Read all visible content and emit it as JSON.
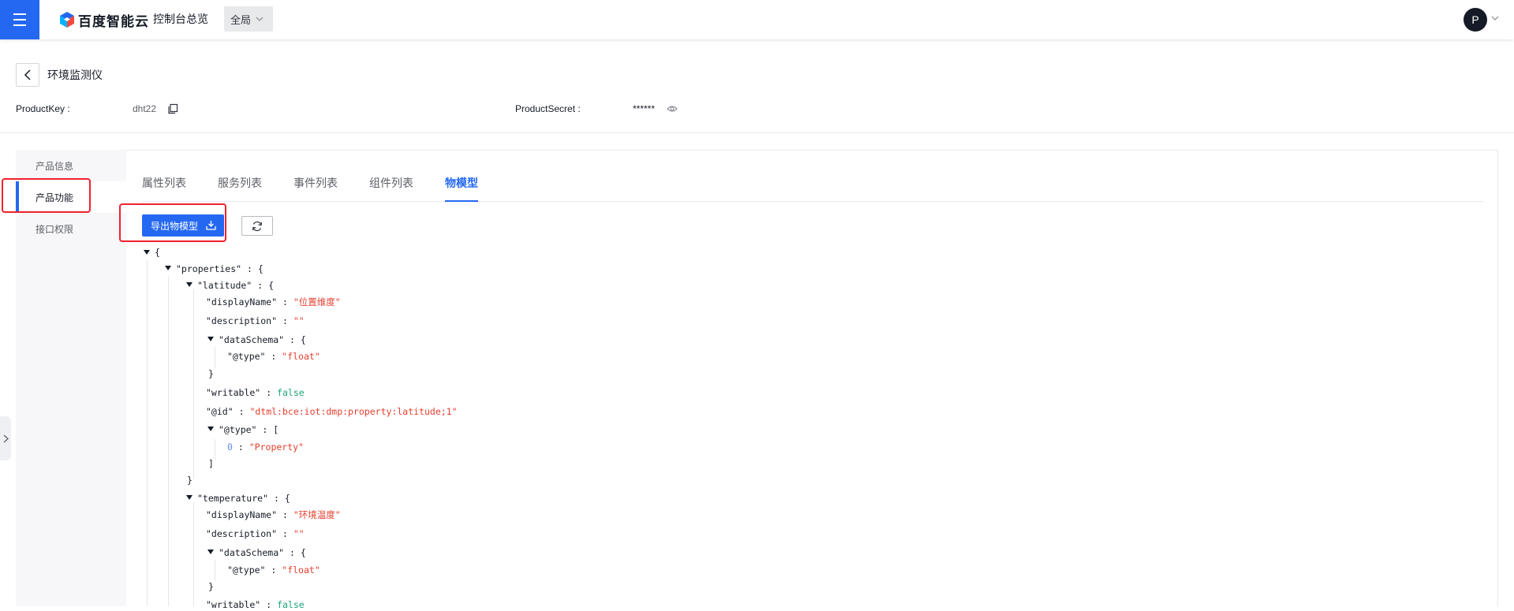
{
  "topbar": {
    "brand": "百度智能云",
    "console_title": "控制台总览",
    "region": "全局",
    "avatar_letter": "P"
  },
  "header": {
    "title": "环境监测仪",
    "product_key_label": "ProductKey :",
    "product_key_value": "dht22",
    "product_secret_label": "ProductSecret :",
    "product_secret_value": "******"
  },
  "sidebar": {
    "items": [
      {
        "label": "产品信息",
        "active": false
      },
      {
        "label": "产品功能",
        "active": true
      },
      {
        "label": "接口权限",
        "active": false
      }
    ]
  },
  "tabs": [
    {
      "label": "属性列表",
      "active": false
    },
    {
      "label": "服务列表",
      "active": false
    },
    {
      "label": "事件列表",
      "active": false
    },
    {
      "label": "组件列表",
      "active": false
    },
    {
      "label": "物模型",
      "active": true
    }
  ],
  "toolbar": {
    "export_label": "导出物模型"
  },
  "json_tree": {
    "open_brace": "{",
    "close_brace": "}",
    "open_bracket": "[",
    "close_bracket": "]",
    "colon": ":",
    "k_properties": "\"properties\"",
    "k_latitude": "\"latitude\"",
    "k_displayName": "\"displayName\"",
    "v_latitude_name": "\"位置维度\"",
    "k_description": "\"description\"",
    "v_empty": "\"\"",
    "k_dataSchema": "\"dataSchema\"",
    "k_at_type": "\"@type\"",
    "v_float": "\"float\"",
    "k_writable": "\"writable\"",
    "v_false": "false",
    "k_at_id": "\"@id\"",
    "v_latitude_id": "\"dtml:bce:iot:dmp:property:latitude;1\"",
    "idx_0": "0",
    "v_property": "\"Property\"",
    "k_temperature": "\"temperature\"",
    "v_temperature_name": "\"环境温度\""
  },
  "colors": {
    "primary": "#2468f2",
    "annotation_red": "#f0222d",
    "string_value": "#e63e2e",
    "boolean_value": "#1aa37a"
  }
}
